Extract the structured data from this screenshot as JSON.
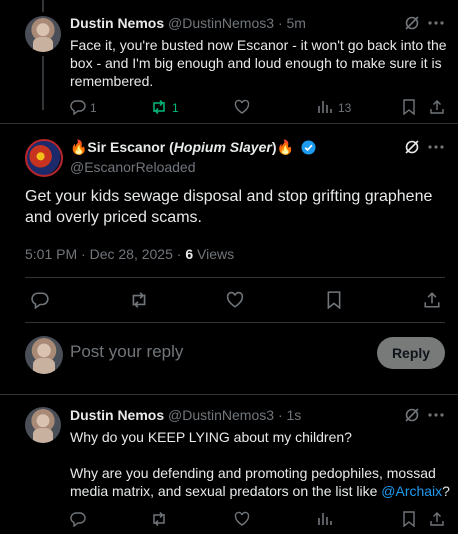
{
  "thread": {
    "top_tweet": {
      "display_name": "Dustin Nemos",
      "handle": "@DustinNemos3",
      "separator": "·",
      "time": "5m",
      "text": "Face it, you're busted now Escanor - it won't go back into the box - and I'm big enough and loud enough to make  sure it is remembered.",
      "reply_count": "1",
      "repost_count": "1",
      "views_count": "13"
    },
    "main_tweet": {
      "display_name_prefix": "🔥Sir Escanor (",
      "display_name_italic": "Hopium Slayer",
      "display_name_suffix": ")🔥",
      "handle": "@EscanorReloaded",
      "text": "Get your kids sewage disposal and stop grifting graphene and overly priced scams.",
      "timestamp": "5:01 PM · Dec 28, 2025 · ",
      "views_value": "6",
      "views_label": " Views"
    },
    "reply_box": {
      "placeholder": "Post your reply",
      "button_label": "Reply"
    },
    "reply_tweet": {
      "display_name": "Dustin Nemos",
      "handle": "@DustinNemos3",
      "separator": "·",
      "time": "1s",
      "line1": "Why do you KEEP LYING about my children?",
      "line2_text": "Why are you defending and promoting pedophiles, mossad media matrix, and sexual predators on the list like ",
      "mention": "@Archaix",
      "line2_end": "?"
    }
  },
  "colors": {
    "background": "#000000",
    "text": "#e7e9ea",
    "muted": "#71767b",
    "link": "#1d9bf0",
    "repost_active": "#00ba7c",
    "verified": "#1d9bf0"
  }
}
